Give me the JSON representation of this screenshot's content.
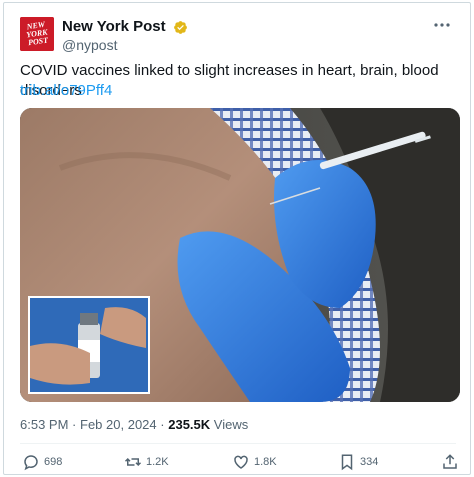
{
  "account": {
    "display_name": "New York Post",
    "handle": "@nypost",
    "logo_text": [
      "NEW",
      "YORK",
      "POST"
    ],
    "brand_color": "#cc1b28",
    "verified_color": "#e2b719"
  },
  "post": {
    "text": "COVID vaccines linked to slight increases in heart, brain, blood disorders",
    "link": "trib.al/o79Pff4",
    "link_color": "#1d9bf0",
    "time": "6:53 PM",
    "date": "Feb 20, 2024",
    "separator": "·",
    "views_count": "235.5K",
    "views_label": "Views"
  },
  "media": {
    "icon": "photo-vaccination"
  },
  "actions": {
    "replies": "698",
    "reposts": "1.2K",
    "likes": "1.8K",
    "bookmarks": "334",
    "icons": [
      "reply-icon",
      "repost-icon",
      "like-icon",
      "bookmark-icon",
      "share-icon"
    ]
  },
  "more_icon": "more-options-icon"
}
